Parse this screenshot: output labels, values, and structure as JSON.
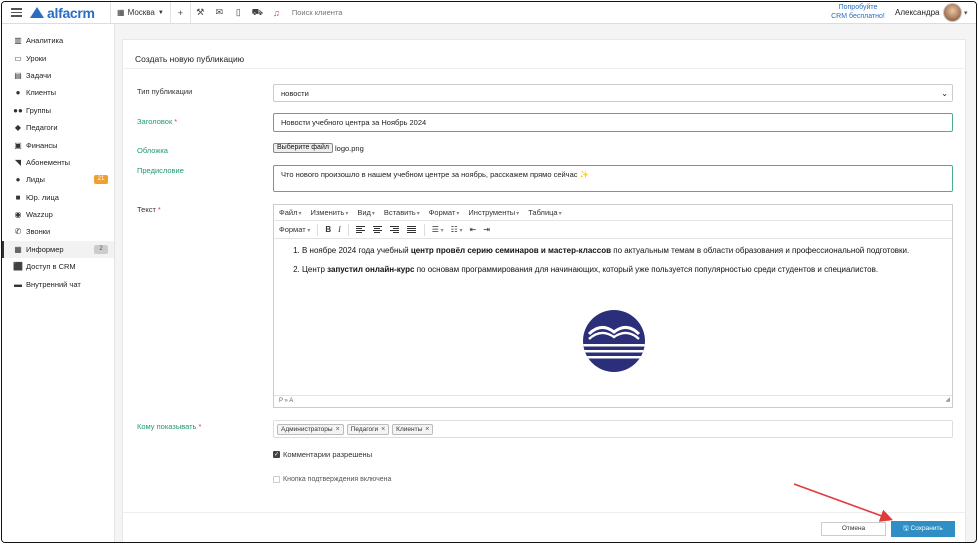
{
  "brand": {
    "name": "alfacrm",
    "color": "#2a6ec2"
  },
  "topbar": {
    "branch": "Москва",
    "search_placeholder": "Поиск клиента",
    "promo": [
      "Попробуйте",
      "CRM бесплатно!"
    ],
    "user_name": "Александра",
    "icons": [
      "plus-icon",
      "wrench-icon",
      "mail-icon",
      "mobile-icon",
      "cart-icon",
      "bell-icon"
    ]
  },
  "sidebar": {
    "items": [
      {
        "label": "Аналитика",
        "icon": "analytics-icon"
      },
      {
        "label": "Уроки",
        "icon": "calendar-icon"
      },
      {
        "label": "Задачи",
        "icon": "tasks-icon"
      },
      {
        "label": "Клиенты",
        "icon": "user-icon"
      },
      {
        "label": "Группы",
        "icon": "group-icon"
      },
      {
        "label": "Педагоги",
        "icon": "teacher-icon"
      },
      {
        "label": "Финансы",
        "icon": "money-icon"
      },
      {
        "label": "Абонементы",
        "icon": "tag-icon"
      },
      {
        "label": "Лиды",
        "icon": "leads-icon",
        "badge": "21"
      },
      {
        "label": "Юр. лица",
        "icon": "briefcase-icon"
      },
      {
        "label": "Wazzup",
        "icon": "whatsapp-icon"
      },
      {
        "label": "Звонки",
        "icon": "phone-icon"
      },
      {
        "label": "Информер",
        "icon": "newspaper-icon",
        "badge": "2",
        "active": true
      },
      {
        "label": "Доступ в CRM",
        "icon": "lock-icon"
      },
      {
        "label": "Внутренний чат",
        "icon": "chat-icon"
      }
    ]
  },
  "form": {
    "title": "Создать новую публикацию",
    "type_label": "Тип публикации",
    "type_value": "новости",
    "heading_label": "Заголовок",
    "heading_value": "Новости учебного центра за Ноябрь 2024",
    "cover_label": "Обложка",
    "file_button": "Выберите файл",
    "file_name": "logo.png",
    "preface_label": "Предисловие",
    "preface_value": "Что нового произошло в нашем учебном центре за ноябрь, расскажем прямо сейчас",
    "text_label": "Текст",
    "required_mark": "*",
    "editor": {
      "menu": [
        "Файл",
        "Изменить",
        "Вид",
        "Вставить",
        "Формат",
        "Инструменты",
        "Таблица"
      ],
      "format_label": "Формат",
      "list": [
        {
          "pre": "В ноябре 2024 года учебный ",
          "bold": "центр провёл серию семинаров и мастер-классов",
          "post": " по актуальным темам в области образования и профессиональной подготовки."
        },
        {
          "pre": "Центр ",
          "bold": "запустил онлайн-курс",
          "post": " по основам программирования для начинающих, который уже пользуется популярностью среди студентов и специалистов."
        }
      ],
      "status": "P » A"
    },
    "audience_label": "Кому показывать",
    "audience_tags": [
      "Администраторы",
      "Педагоги",
      "Клиенты"
    ],
    "comments_label": "Комментарии разрешены",
    "comments_checked": true,
    "confirm_label": "Кнопка подтверждения включена",
    "confirm_checked": false,
    "cancel_button": "Отмена",
    "save_button": "Сохранить"
  },
  "colors": {
    "accent": "#2f8fc4",
    "green_label": "#1f9a6e",
    "arrow": "#e03a3a",
    "logo_navy": "#2b2f7a"
  }
}
